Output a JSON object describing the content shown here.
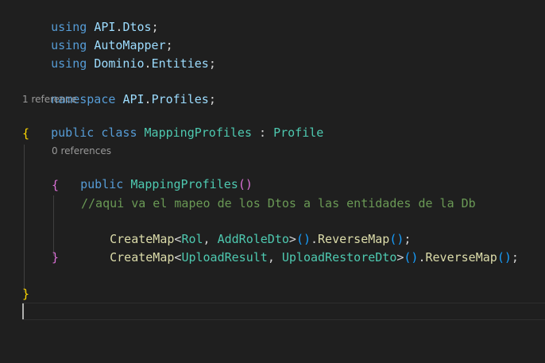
{
  "editor": {
    "lines": {
      "using1": {
        "kw": "using",
        "ns": "API",
        "ns2": "Dtos",
        "end": ";"
      },
      "using2": {
        "kw": "using",
        "ns": "AutoMapper",
        "end": ";"
      },
      "using3": {
        "kw": "using",
        "ns": "Dominio",
        "ns2": "Entities",
        "end": ";"
      },
      "namespace": {
        "kw": "namespace",
        "ns": "API",
        "ns2": "Profiles",
        "end": ";"
      },
      "class_lens": "1 reference",
      "class_decl": {
        "access": "public",
        "kw": "class",
        "name": "MappingProfiles",
        "sep": ":",
        "base": "Profile"
      },
      "class_open": "{",
      "ctor_lens": "0 references",
      "ctor_decl": {
        "access": "public",
        "name": "MappingProfiles",
        "open": "(",
        "close": ")"
      },
      "ctor_open": "{",
      "comment": "//aqui va el mapeo de los Dtos a las entidades de la Db",
      "map1": {
        "fn": "CreateMap",
        "lt": "<",
        "t1": "Rol",
        "comma": ",",
        "t2": "AddRoleDto",
        "gt": ">",
        "call": "()",
        "dot": ".",
        "fn2": "ReverseMap",
        "call2": "()",
        "end": ";"
      },
      "map2": {
        "fn": "CreateMap",
        "lt": "<",
        "t1": "UploadResult",
        "comma": ",",
        "t2": "UploadRestoreDto",
        "gt": ">",
        "call": "()",
        "dot": ".",
        "fn2": "ReverseMap",
        "call2": "()",
        "end": ";"
      },
      "ctor_close": "}",
      "class_close": "}"
    }
  },
  "colors": {
    "background": "#1f1f1f",
    "keyword": "#569cd6",
    "control_keyword": "#c586c0",
    "namespace": "#9cdcfe",
    "type": "#4ec9b0",
    "function": "#dcdcaa",
    "comment": "#6a9955",
    "bracket_level1": "#ffd700",
    "bracket_level2": "#da70d6",
    "bracket_level3": "#179fff"
  }
}
